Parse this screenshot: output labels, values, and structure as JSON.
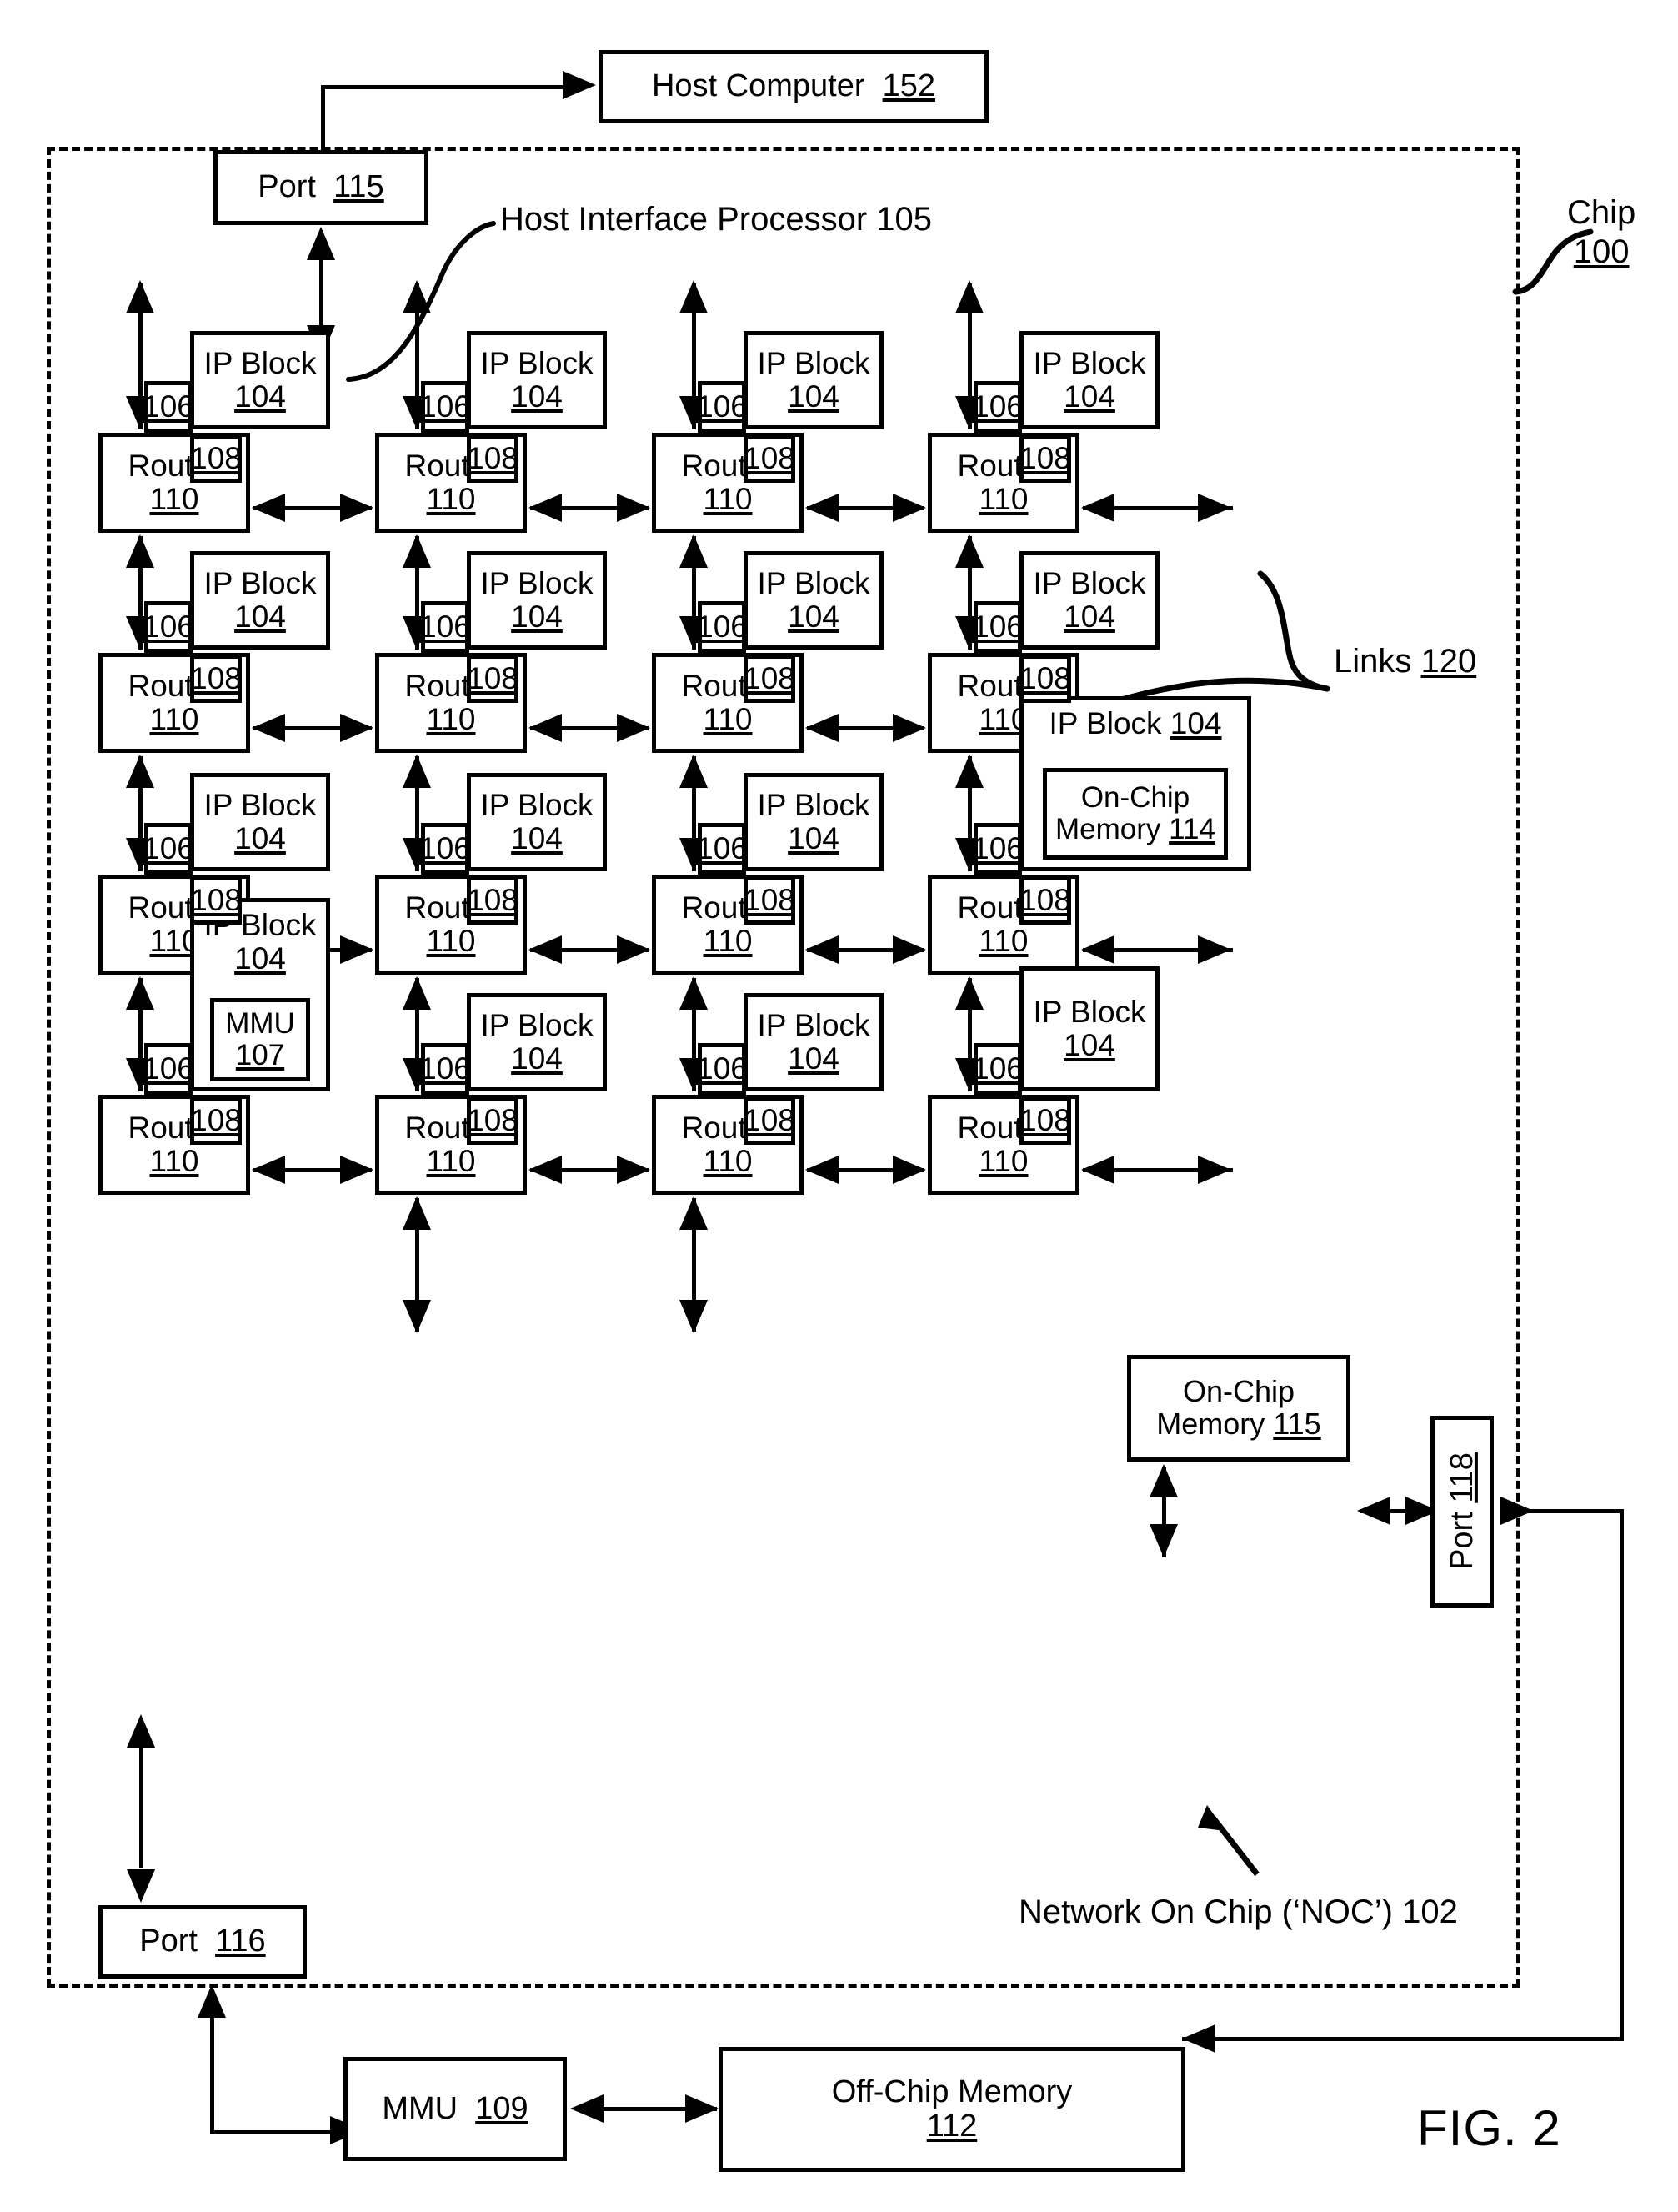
{
  "figure": {
    "label": "FIG. 2",
    "title": "Network On Chip"
  },
  "callouts": {
    "chip": {
      "line1": "Chip",
      "line2": "100"
    },
    "host_interface_processor": "Host Interface Processor 105",
    "links": "Links 120",
    "noc": "Network On Chip (‘NOC’) 102"
  },
  "boxes": {
    "host_computer": {
      "text": "Host Computer",
      "ref": "152"
    },
    "port_115": {
      "text": "Port",
      "ref": "115"
    },
    "port_116": {
      "text": "Port",
      "ref": "116"
    },
    "port_118": {
      "text": "Port",
      "ref": "118"
    },
    "mmu_109": {
      "text": "MMU",
      "ref": "109"
    },
    "off_chip_memory": {
      "line1": "Off-Chip Memory",
      "ref": "112"
    },
    "on_chip_memory_115": {
      "line1": "On-Chip",
      "line2": "Memory",
      "ref": "115"
    },
    "on_chip_memory_114": {
      "line1": "On-Chip",
      "line2": "Memory",
      "ref": "114"
    },
    "mmu_107": {
      "text": "MMU",
      "ref": "107"
    }
  },
  "cell_labels": {
    "ip_block": "IP Block",
    "ip_block_ref": "104",
    "router": "Router",
    "router_ref": "110",
    "tag_106": "106",
    "tag_108": "108"
  },
  "grid": {
    "rows": 4,
    "cols": 4,
    "cells": [
      {
        "row": 1,
        "col": 1,
        "ip_block": "IP Block",
        "ip_ref": "104",
        "router": "Router",
        "router_ref": "110",
        "tag_a": "106",
        "tag_b": "108",
        "variant": "plain"
      },
      {
        "row": 1,
        "col": 2,
        "ip_block": "IP Block",
        "ip_ref": "104",
        "router": "Router",
        "router_ref": "110",
        "tag_a": "106",
        "tag_b": "108",
        "variant": "plain"
      },
      {
        "row": 1,
        "col": 3,
        "ip_block": "IP Block",
        "ip_ref": "104",
        "router": "Router",
        "router_ref": "110",
        "tag_a": "106",
        "tag_b": "108",
        "variant": "plain"
      },
      {
        "row": 1,
        "col": 4,
        "ip_block": "IP Block",
        "ip_ref": "104",
        "router": "Router",
        "router_ref": "110",
        "tag_a": "106",
        "tag_b": "108",
        "variant": "plain"
      },
      {
        "row": 2,
        "col": 1,
        "ip_block": "IP Block",
        "ip_ref": "104",
        "router": "Router",
        "router_ref": "110",
        "tag_a": "106",
        "tag_b": "108",
        "variant": "plain"
      },
      {
        "row": 2,
        "col": 2,
        "ip_block": "IP Block",
        "ip_ref": "104",
        "router": "Router",
        "router_ref": "110",
        "tag_a": "106",
        "tag_b": "108",
        "variant": "plain"
      },
      {
        "row": 2,
        "col": 3,
        "ip_block": "IP Block",
        "ip_ref": "104",
        "router": "Router",
        "router_ref": "110",
        "tag_a": "106",
        "tag_b": "108",
        "variant": "plain"
      },
      {
        "row": 2,
        "col": 4,
        "ip_block": "IP Block",
        "ip_ref": "104",
        "router": "Router",
        "router_ref": "110",
        "tag_a": "106",
        "tag_b": "108",
        "variant": "plain"
      },
      {
        "row": 3,
        "col": 1,
        "ip_block": "IP Block",
        "ip_ref": "104",
        "router": "Router",
        "router_ref": "110",
        "tag_a": "106",
        "tag_b": "108",
        "variant": "plain"
      },
      {
        "row": 3,
        "col": 2,
        "ip_block": "IP Block",
        "ip_ref": "104",
        "router": "Router",
        "router_ref": "110",
        "tag_a": "106",
        "tag_b": "108",
        "variant": "plain"
      },
      {
        "row": 3,
        "col": 3,
        "ip_block": "IP Block",
        "ip_ref": "104",
        "router": "Router",
        "router_ref": "110",
        "tag_a": "106",
        "tag_b": "108",
        "variant": "plain"
      },
      {
        "row": 3,
        "col": 4,
        "ip_block": "IP Block",
        "ip_ref": "104",
        "router": "Router",
        "router_ref": "110",
        "tag_a": "106",
        "tag_b": "108",
        "variant": "on-chip-memory-114"
      },
      {
        "row": 4,
        "col": 1,
        "ip_block": "IP Block",
        "ip_ref": "104",
        "router": "Router",
        "router_ref": "110",
        "tag_a": "106",
        "tag_b": "108",
        "variant": "mmu-107"
      },
      {
        "row": 4,
        "col": 2,
        "ip_block": "IP Block",
        "ip_ref": "104",
        "router": "Router",
        "router_ref": "110",
        "tag_a": "106",
        "tag_b": "108",
        "variant": "plain"
      },
      {
        "row": 4,
        "col": 3,
        "ip_block": "IP Block",
        "ip_ref": "104",
        "router": "Router",
        "router_ref": "110",
        "tag_a": "106",
        "tag_b": "108",
        "variant": "plain"
      },
      {
        "row": 4,
        "col": 4,
        "ip_block": "IP Block",
        "ip_ref": "104",
        "router": "Router",
        "router_ref": "110",
        "tag_a": "106",
        "tag_b": "108",
        "variant": "on-chip-memory-115"
      }
    ]
  },
  "colors": {
    "ink": "#000000",
    "paper": "#ffffff"
  }
}
